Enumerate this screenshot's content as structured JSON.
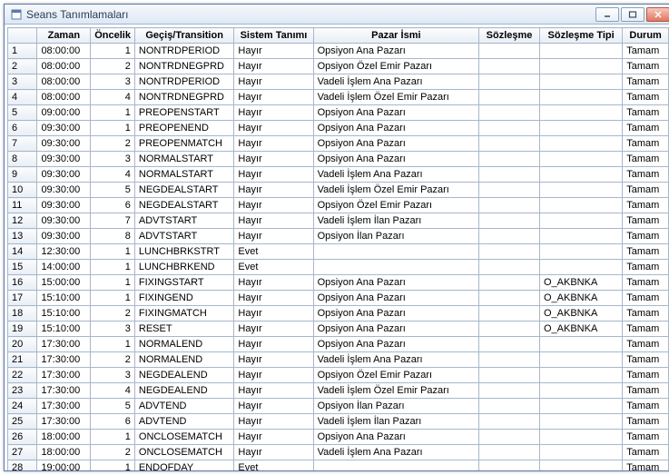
{
  "window": {
    "title": "Seans Tanımlamaları"
  },
  "columns": {
    "zaman": "Zaman",
    "oncelik": "Öncelik",
    "gecis": "Geçiş/Transition",
    "sistem": "Sistem Tanımı",
    "pazar": "Pazar İsmi",
    "sozlesme": "Sözleşme",
    "tipi": "Sözleşme Tipi",
    "durum": "Durum"
  },
  "rows": [
    {
      "n": "1",
      "zaman": "08:00:00",
      "oncelik": "1",
      "gecis": "NONTRDPERIOD",
      "sistem": "Hayır",
      "pazar": "Opsiyon Ana Pazarı",
      "sozlesme": "",
      "tipi": "",
      "durum": "Tamam"
    },
    {
      "n": "2",
      "zaman": "08:00:00",
      "oncelik": "2",
      "gecis": "NONTRDNEGPRD",
      "sistem": "Hayır",
      "pazar": "Opsiyon Özel Emir Pazarı",
      "sozlesme": "",
      "tipi": "",
      "durum": "Tamam"
    },
    {
      "n": "3",
      "zaman": "08:00:00",
      "oncelik": "3",
      "gecis": "NONTRDPERIOD",
      "sistem": "Hayır",
      "pazar": "Vadeli İşlem Ana Pazarı",
      "sozlesme": "",
      "tipi": "",
      "durum": "Tamam"
    },
    {
      "n": "4",
      "zaman": "08:00:00",
      "oncelik": "4",
      "gecis": "NONTRDNEGPRD",
      "sistem": "Hayır",
      "pazar": "Vadeli İşlem Özel Emir Pazarı",
      "sozlesme": "",
      "tipi": "",
      "durum": "Tamam"
    },
    {
      "n": "5",
      "zaman": "09:00:00",
      "oncelik": "1",
      "gecis": "PREOPENSTART",
      "sistem": "Hayır",
      "pazar": "Opsiyon Ana Pazarı",
      "sozlesme": "",
      "tipi": "",
      "durum": "Tamam"
    },
    {
      "n": "6",
      "zaman": "09:30:00",
      "oncelik": "1",
      "gecis": "PREOPENEND",
      "sistem": "Hayır",
      "pazar": "Opsiyon Ana Pazarı",
      "sozlesme": "",
      "tipi": "",
      "durum": "Tamam"
    },
    {
      "n": "7",
      "zaman": "09:30:00",
      "oncelik": "2",
      "gecis": "PREOPENMATCH",
      "sistem": "Hayır",
      "pazar": "Opsiyon Ana Pazarı",
      "sozlesme": "",
      "tipi": "",
      "durum": "Tamam"
    },
    {
      "n": "8",
      "zaman": "09:30:00",
      "oncelik": "3",
      "gecis": "NORMALSTART",
      "sistem": "Hayır",
      "pazar": "Opsiyon Ana Pazarı",
      "sozlesme": "",
      "tipi": "",
      "durum": "Tamam"
    },
    {
      "n": "9",
      "zaman": "09:30:00",
      "oncelik": "4",
      "gecis": "NORMALSTART",
      "sistem": "Hayır",
      "pazar": "Vadeli İşlem Ana Pazarı",
      "sozlesme": "",
      "tipi": "",
      "durum": "Tamam"
    },
    {
      "n": "10",
      "zaman": "09:30:00",
      "oncelik": "5",
      "gecis": "NEGDEALSTART",
      "sistem": "Hayır",
      "pazar": "Vadeli İşlem Özel Emir Pazarı",
      "sozlesme": "",
      "tipi": "",
      "durum": "Tamam"
    },
    {
      "n": "11",
      "zaman": "09:30:00",
      "oncelik": "6",
      "gecis": "NEGDEALSTART",
      "sistem": "Hayır",
      "pazar": "Opsiyon Özel Emir Pazarı",
      "sozlesme": "",
      "tipi": "",
      "durum": "Tamam"
    },
    {
      "n": "12",
      "zaman": "09:30:00",
      "oncelik": "7",
      "gecis": "ADVTSTART",
      "sistem": "Hayır",
      "pazar": "Vadeli İşlem İlan Pazarı",
      "sozlesme": "",
      "tipi": "",
      "durum": "Tamam"
    },
    {
      "n": "13",
      "zaman": "09:30:00",
      "oncelik": "8",
      "gecis": "ADVTSTART",
      "sistem": "Hayır",
      "pazar": "Opsiyon İlan Pazarı",
      "sozlesme": "",
      "tipi": "",
      "durum": "Tamam"
    },
    {
      "n": "14",
      "zaman": "12:30:00",
      "oncelik": "1",
      "gecis": "LUNCHBRKSTRT",
      "sistem": "Evet",
      "pazar": "",
      "sozlesme": "",
      "tipi": "",
      "durum": "Tamam"
    },
    {
      "n": "15",
      "zaman": "14:00:00",
      "oncelik": "1",
      "gecis": "LUNCHBRKEND",
      "sistem": "Evet",
      "pazar": "",
      "sozlesme": "",
      "tipi": "",
      "durum": "Tamam"
    },
    {
      "n": "16",
      "zaman": "15:00:00",
      "oncelik": "1",
      "gecis": "FIXINGSTART",
      "sistem": "Hayır",
      "pazar": "Opsiyon Ana Pazarı",
      "sozlesme": "",
      "tipi": "O_AKBNKA",
      "durum": "Tamam"
    },
    {
      "n": "17",
      "zaman": "15:10:00",
      "oncelik": "1",
      "gecis": "FIXINGEND",
      "sistem": "Hayır",
      "pazar": "Opsiyon Ana Pazarı",
      "sozlesme": "",
      "tipi": "O_AKBNKA",
      "durum": "Tamam"
    },
    {
      "n": "18",
      "zaman": "15:10:00",
      "oncelik": "2",
      "gecis": "FIXINGMATCH",
      "sistem": "Hayır",
      "pazar": "Opsiyon Ana Pazarı",
      "sozlesme": "",
      "tipi": "O_AKBNKA",
      "durum": "Tamam"
    },
    {
      "n": "19",
      "zaman": "15:10:00",
      "oncelik": "3",
      "gecis": "RESET",
      "sistem": "Hayır",
      "pazar": "Opsiyon Ana Pazarı",
      "sozlesme": "",
      "tipi": "O_AKBNKA",
      "durum": "Tamam"
    },
    {
      "n": "20",
      "zaman": "17:30:00",
      "oncelik": "1",
      "gecis": "NORMALEND",
      "sistem": "Hayır",
      "pazar": "Opsiyon Ana Pazarı",
      "sozlesme": "",
      "tipi": "",
      "durum": "Tamam"
    },
    {
      "n": "21",
      "zaman": "17:30:00",
      "oncelik": "2",
      "gecis": "NORMALEND",
      "sistem": "Hayır",
      "pazar": "Vadeli İşlem Ana Pazarı",
      "sozlesme": "",
      "tipi": "",
      "durum": "Tamam"
    },
    {
      "n": "22",
      "zaman": "17:30:00",
      "oncelik": "3",
      "gecis": "NEGDEALEND",
      "sistem": "Hayır",
      "pazar": "Opsiyon Özel Emir Pazarı",
      "sozlesme": "",
      "tipi": "",
      "durum": "Tamam"
    },
    {
      "n": "23",
      "zaman": "17:30:00",
      "oncelik": "4",
      "gecis": "NEGDEALEND",
      "sistem": "Hayır",
      "pazar": "Vadeli İşlem Özel Emir Pazarı",
      "sozlesme": "",
      "tipi": "",
      "durum": "Tamam"
    },
    {
      "n": "24",
      "zaman": "17:30:00",
      "oncelik": "5",
      "gecis": "ADVTEND",
      "sistem": "Hayır",
      "pazar": "Opsiyon İlan Pazarı",
      "sozlesme": "",
      "tipi": "",
      "durum": "Tamam"
    },
    {
      "n": "25",
      "zaman": "17:30:00",
      "oncelik": "6",
      "gecis": "ADVTEND",
      "sistem": "Hayır",
      "pazar": "Vadeli İşlem İlan Pazarı",
      "sozlesme": "",
      "tipi": "",
      "durum": "Tamam"
    },
    {
      "n": "26",
      "zaman": "18:00:00",
      "oncelik": "1",
      "gecis": "ONCLOSEMATCH",
      "sistem": "Hayır",
      "pazar": "Opsiyon Ana Pazarı",
      "sozlesme": "",
      "tipi": "",
      "durum": "Tamam"
    },
    {
      "n": "27",
      "zaman": "18:00:00",
      "oncelik": "2",
      "gecis": "ONCLOSEMATCH",
      "sistem": "Hayır",
      "pazar": "Vadeli İşlem Ana Pazarı",
      "sozlesme": "",
      "tipi": "",
      "durum": "Tamam"
    },
    {
      "n": "28",
      "zaman": "19:00:00",
      "oncelik": "1",
      "gecis": "ENDOFDAY",
      "sistem": "Evet",
      "pazar": "",
      "sozlesme": "",
      "tipi": "",
      "durum": "Tamam"
    }
  ]
}
